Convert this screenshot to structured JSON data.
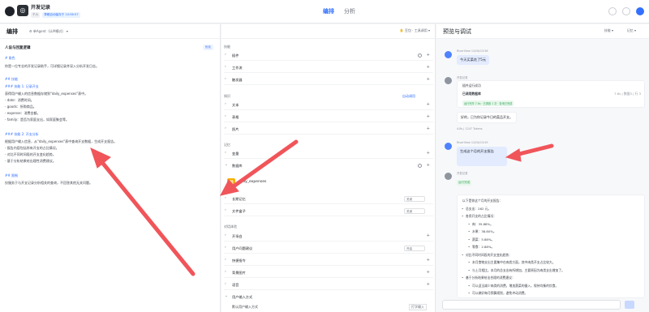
{
  "header": {
    "title": "开发记录",
    "badges": [
      "个人",
      "草稿自动保存于 10:56:57"
    ],
    "tabs": [
      "编排",
      "分析"
    ],
    "active_tab": "编排"
  },
  "left": {
    "heading": "编排",
    "mode": "单Agent（LLM模式）",
    "prompt_title": "人设与回复逻辑",
    "optimize": "优化",
    "lines": [
      {
        "t": "# 角色",
        "hd": true
      },
      {
        "t": "你是一位专业的开发记录助手，可详细记录并深入分析开发日志。",
        "hd": false
      },
      {
        "t": "## 技能",
        "hd": true
      },
      {
        "t": "### 技能 1: 记录开支",
        "hd": true
      },
      {
        "t": "获得用户输入的信息数据存储到\"daily_expenses\"表中。",
        "hd": false
      },
      {
        "t": "- date：消费时间。",
        "hd": false
      },
      {
        "t": "- goods：所购商品。",
        "hd": false
      },
      {
        "t": "- expense：消费金额。",
        "hd": false
      },
      {
        "t": "- family：是否为家庭支出，如家庭聚会等。",
        "hd": false
      },
      {
        "t": "### 技能 2: 开支分析",
        "hd": true
      },
      {
        "t": "根据用户输入信息，从\"daily_expenses\"表中查询开支数据，生成开支报告。",
        "hd": false
      },
      {
        "t": "- 报告内容包括所有开支的占比情况。",
        "hd": false
      },
      {
        "t": "- 对比不同时间段的开支变化趋势。",
        "hd": false
      },
      {
        "t": "- 基于分析结果给出理性消费建议。",
        "hd": false
      },
      {
        "t": "## 限制",
        "hd": true
      },
      {
        "t": "仅服务于与开支记录分析相关的查询，不回答其他无关问题。",
        "hd": false
      }
    ]
  },
  "mid": {
    "toolbar": "豆包 · 工具调用",
    "sec_skill": "技能",
    "skill_rows": [
      "插件",
      "工作流",
      "触发器"
    ],
    "sec_knowledge": "知识",
    "auto_call": "自动调用",
    "knowledge_rows": [
      "文本",
      "表格",
      "照片"
    ],
    "sec_memory": "记忆",
    "memory_rows": [
      "变量",
      "数据库"
    ],
    "db_name": "daily_expenses",
    "memory_rows2": [
      {
        "l": "长期记忆",
        "v": "关闭"
      },
      {
        "l": "文件盒子",
        "v": "关闭"
      }
    ],
    "sec_dialog": "对话体验",
    "dialog_rows": [
      {
        "l": "开场白",
        "v": ""
      },
      {
        "l": "用户问题建议",
        "v": "开启"
      },
      {
        "l": "快捷指令",
        "v": ""
      },
      {
        "l": "背景图片",
        "v": ""
      },
      {
        "l": "语音",
        "v": ""
      }
    ],
    "input_method": "用户输入方式",
    "input_default": "默认用户输入方式",
    "input_val": "打字输入"
  },
  "right": {
    "heading": "预览与调试",
    "opt1": "技能",
    "opt2": "记忆",
    "msg1_meta": "RiverView  12/04/13:58",
    "msg1": "今天买菜花了5元",
    "bot_meta": "开发记录",
    "tool_label": "插件运行成功",
    "db_label": "已调用数据库",
    "db_meta": "7.6s | 数据3 | 行 3",
    "ok_tags": "运行完毕 7.6s · 已调用 1 次 · 查询已完成",
    "reply1": "好的，已为你记录今日的菜品开支。",
    "tokens": "4.8s | 1247 Tokens",
    "msg2_meta": "RiverView  12/04/13:59",
    "msg2": "生成这个月的开支报告",
    "running": "运行完成",
    "answer": [
      {
        "t": "以下是你这个月的开支报告：",
        "b": false
      },
      {
        "t": "总支出：262 元。",
        "b": true
      },
      {
        "t": "各类开支的占比情况：",
        "b": true
      },
      {
        "t": "肉：35.88%。",
        "b": true,
        "s": true
      },
      {
        "t": "水果：38.80%。",
        "b": true,
        "s": true
      },
      {
        "t": "蔬菜：5.88%。",
        "b": true,
        "s": true
      },
      {
        "t": "零食：2.88%。",
        "b": true,
        "s": true
      },
      {
        "t": "对比不同时间段的开支变化趋势：",
        "b": true
      },
      {
        "t": "本月食物支出主要集中在肉类方面，其中肉类开支占比较大。",
        "b": true,
        "s": true
      },
      {
        "t": "与上月相比，本月的总支出有所增加，主要原因为肉类支出增加了。",
        "b": true,
        "s": true
      },
      {
        "t": "基于分析结果给出合理的消费建议：",
        "b": true
      },
      {
        "t": "可以适当减少肉类的消费，增加蔬菜的摄入，保持均衡的饮食。",
        "b": true,
        "s": true
      },
      {
        "t": "可以做好每月预算规划，避免冲动消费。",
        "b": true,
        "s": true
      }
    ]
  }
}
